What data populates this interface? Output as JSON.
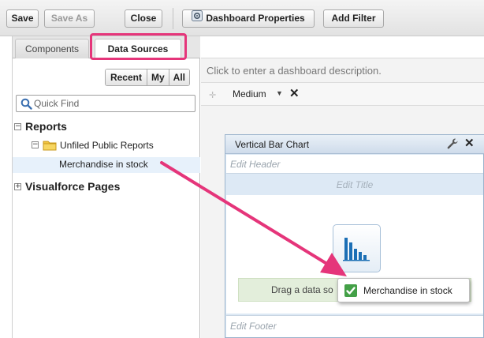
{
  "toolbar": {
    "save_label": "Save",
    "save_as_label": "Save As",
    "close_label": "Close",
    "dashboard_properties_label": "Dashboard Properties",
    "add_filter_label": "Add Filter"
  },
  "left_panel": {
    "tabs": [
      {
        "label": "Components",
        "active": false
      },
      {
        "label": "Data Sources",
        "active": true
      }
    ],
    "filter_segments": [
      "Recent",
      "My",
      "All"
    ],
    "search": {
      "placeholder": "Quick Find",
      "value": ""
    },
    "tree": {
      "reports_label": "Reports",
      "folder_label": "Unfiled Public Reports",
      "report_item_label": "Merchandise in stock",
      "visualforce_label": "Visualforce Pages"
    }
  },
  "canvas": {
    "description_prompt": "Click to enter a dashboard description.",
    "column_size": "Medium",
    "component": {
      "title": "Vertical Bar Chart",
      "edit_header": "Edit Header",
      "edit_title": "Edit Title",
      "drop_text": "Drag a data so",
      "edit_footer": "Edit Footer"
    },
    "drag_chip_label": "Merchandise in stock"
  },
  "colors": {
    "annotation_pink": "#e5357a",
    "check_green": "#43a047",
    "component_blue": "#dde9f5",
    "selected_row": "#e7f1fb"
  },
  "icons": [
    "dashboard-properties-icon",
    "search-icon",
    "folder-icon",
    "wrench-icon",
    "close-icon",
    "vertical-bar-chart-icon",
    "checkmark-icon",
    "annotation-arrow"
  ]
}
